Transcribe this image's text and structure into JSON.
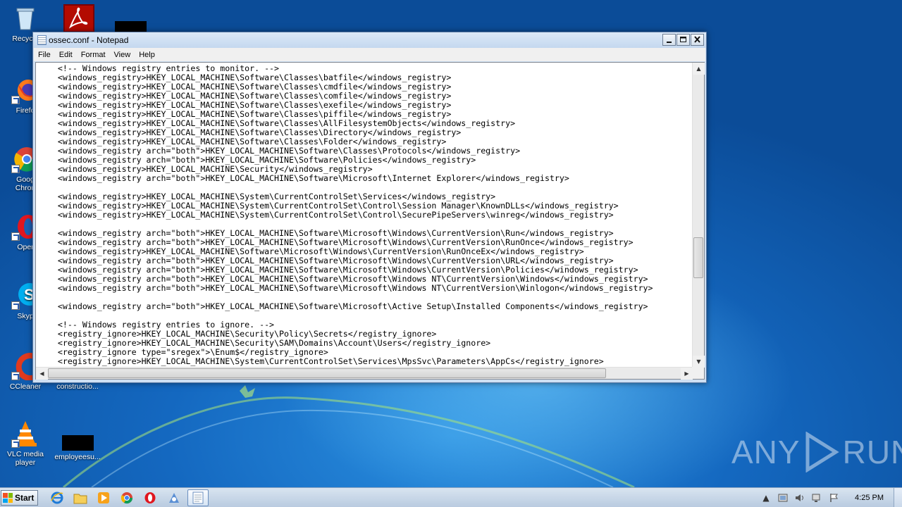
{
  "window": {
    "title": "ossec.conf - Notepad",
    "minimize_glyph": "0",
    "maximize_glyph": "1",
    "close_glyph": "r"
  },
  "menu": [
    "File",
    "Edit",
    "Format",
    "View",
    "Help"
  ],
  "editor": {
    "lines": [
      "    <!-- Windows registry entries to monitor. -->",
      "    <windows_registry>HKEY_LOCAL_MACHINE\\Software\\Classes\\batfile</windows_registry>",
      "    <windows_registry>HKEY_LOCAL_MACHINE\\Software\\Classes\\cmdfile</windows_registry>",
      "    <windows_registry>HKEY_LOCAL_MACHINE\\Software\\Classes\\comfile</windows_registry>",
      "    <windows_registry>HKEY_LOCAL_MACHINE\\Software\\Classes\\exefile</windows_registry>",
      "    <windows_registry>HKEY_LOCAL_MACHINE\\Software\\Classes\\piffile</windows_registry>",
      "    <windows_registry>HKEY_LOCAL_MACHINE\\Software\\Classes\\AllFilesystemObjects</windows_registry>",
      "    <windows_registry>HKEY_LOCAL_MACHINE\\Software\\Classes\\Directory</windows_registry>",
      "    <windows_registry>HKEY_LOCAL_MACHINE\\Software\\Classes\\Folder</windows_registry>",
      "    <windows_registry arch=\"both\">HKEY_LOCAL_MACHINE\\Software\\Classes\\Protocols</windows_registry>",
      "    <windows_registry arch=\"both\">HKEY_LOCAL_MACHINE\\Software\\Policies</windows_registry>",
      "    <windows_registry>HKEY_LOCAL_MACHINE\\Security</windows_registry>",
      "    <windows_registry arch=\"both\">HKEY_LOCAL_MACHINE\\Software\\Microsoft\\Internet Explorer</windows_registry>",
      "",
      "    <windows_registry>HKEY_LOCAL_MACHINE\\System\\CurrentControlSet\\Services</windows_registry>",
      "    <windows_registry>HKEY_LOCAL_MACHINE\\System\\CurrentControlSet\\Control\\Session Manager\\KnownDLLs</windows_registry>",
      "    <windows_registry>HKEY_LOCAL_MACHINE\\System\\CurrentControlSet\\Control\\SecurePipeServers\\winreg</windows_registry>",
      "",
      "    <windows_registry arch=\"both\">HKEY_LOCAL_MACHINE\\Software\\Microsoft\\Windows\\CurrentVersion\\Run</windows_registry>",
      "    <windows_registry arch=\"both\">HKEY_LOCAL_MACHINE\\Software\\Microsoft\\Windows\\CurrentVersion\\RunOnce</windows_registry>",
      "    <windows_registry>HKEY_LOCAL_MACHINE\\Software\\Microsoft\\Windows\\CurrentVersion\\RunOnceEx</windows_registry>",
      "    <windows_registry arch=\"both\">HKEY_LOCAL_MACHINE\\Software\\Microsoft\\Windows\\CurrentVersion\\URL</windows_registry>",
      "    <windows_registry arch=\"both\">HKEY_LOCAL_MACHINE\\Software\\Microsoft\\Windows\\CurrentVersion\\Policies</windows_registry>",
      "    <windows_registry arch=\"both\">HKEY_LOCAL_MACHINE\\Software\\Microsoft\\Windows NT\\CurrentVersion\\Windows</windows_registry>",
      "    <windows_registry arch=\"both\">HKEY_LOCAL_MACHINE\\Software\\Microsoft\\Windows NT\\CurrentVersion\\Winlogon</windows_registry>",
      "",
      "    <windows_registry arch=\"both\">HKEY_LOCAL_MACHINE\\Software\\Microsoft\\Active Setup\\Installed Components</windows_registry>",
      "",
      "    <!-- Windows registry entries to ignore. -->",
      "    <registry_ignore>HKEY_LOCAL_MACHINE\\Security\\Policy\\Secrets</registry_ignore>",
      "    <registry_ignore>HKEY_LOCAL_MACHINE\\Security\\SAM\\Domains\\Account\\Users</registry_ignore>",
      "    <registry_ignore type=\"sregex\">\\Enum$</registry_ignore>",
      "    <registry_ignore>HKEY_LOCAL_MACHINE\\System\\CurrentControlSet\\Services\\MpsSvc\\Parameters\\AppCs</registry_ignore>"
    ]
  },
  "desktop_icons": [
    {
      "label": "Recycle",
      "icon": "recycle-bin-icon"
    },
    {
      "label": "",
      "icon": "acrobat-icon"
    },
    {
      "label": "Firefo",
      "icon": "firefox-icon"
    },
    {
      "label": "Goog\nChron",
      "icon": "chrome-icon"
    },
    {
      "label": "Oper",
      "icon": "opera-icon"
    },
    {
      "label": "Skyp",
      "icon": "skype-icon"
    },
    {
      "label": "CCleaner",
      "icon": "ccleaner-icon"
    },
    {
      "label": "constructio...",
      "icon": "document-icon"
    },
    {
      "label": "VLC media\nplayer",
      "icon": "vlc-icon"
    },
    {
      "label": "employeesu...",
      "icon": "document-icon"
    }
  ],
  "watermark": {
    "left": "ANY",
    "right": "RUN"
  },
  "taskbar": {
    "start_label": "Start",
    "clock": "4:25 PM",
    "colors": {
      "taskbar": "#c8d7e8",
      "accent": "#2a5db0"
    }
  }
}
